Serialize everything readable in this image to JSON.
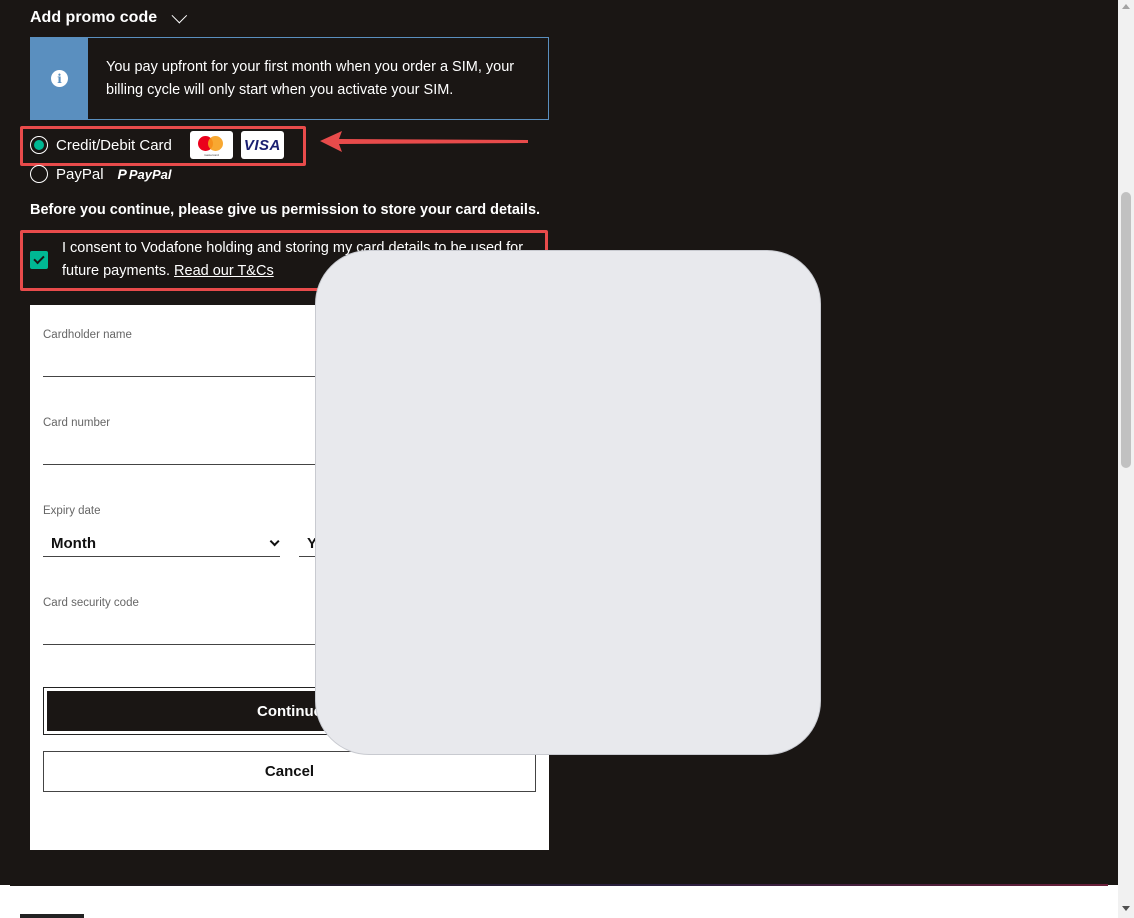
{
  "promo": {
    "label": "Add promo code"
  },
  "info": {
    "icon": "info-icon",
    "text_line1": "You pay upfront for your first month when you order a SIM, your",
    "text_line2": "billing cycle will only start when you activate your SIM."
  },
  "payment": {
    "card_label": "Credit/Debit Card",
    "mastercard_text": "mastercard",
    "visa_text": "VISA",
    "paypal_label": "PayPal",
    "paypal_logo": "PayPal"
  },
  "permission": {
    "heading": "Before you continue, please give us permission to store your card details."
  },
  "consent": {
    "text": "I consent to Vodafone holding and storing my card details to be used for future payments. ",
    "link": "Read our T&Cs"
  },
  "form": {
    "cardholder_label": "Cardholder name",
    "card_number_label": "Card number",
    "expiry_label": "Expiry date",
    "month_value": "Month",
    "year_value": "Y",
    "cvc_label": "Card security code",
    "continue_label": "Continue",
    "cancel_label": "Cancel"
  },
  "colors": {
    "accent": "#00b894",
    "highlight": "#e84b4b",
    "info_blue": "#5a8fbf",
    "background": "#1a1614"
  }
}
